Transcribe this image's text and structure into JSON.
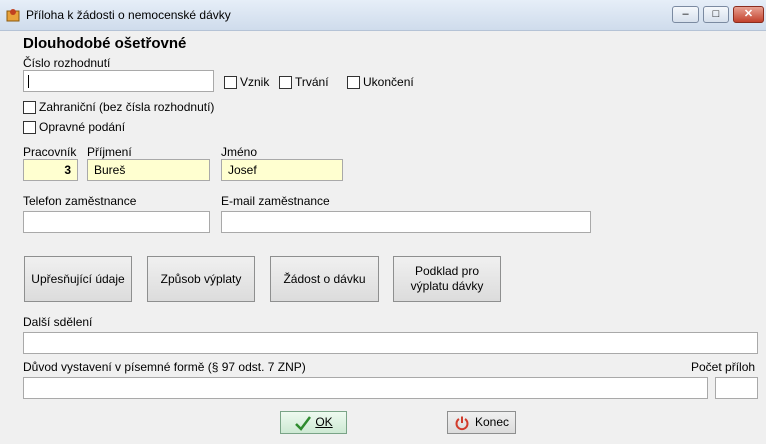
{
  "window": {
    "title": "Příloha k žádosti o nemocenské dávky"
  },
  "form": {
    "heading": "Dlouhodobé ošetřovné",
    "decision_number_label": "Číslo rozhodnutí",
    "decision_number_value": "",
    "checkbox_vznik": "Vznik",
    "checkbox_trvani": "Trvání",
    "checkbox_ukonceni": "Ukončení",
    "checkbox_zahranicni": "Zahraniční (bez čísla rozhodnutí)",
    "checkbox_opravne": "Opravné podání",
    "worker_label": "Pracovník",
    "worker_value": "3",
    "surname_label": "Příjmení",
    "surname_value": "Bureš",
    "name_label": "Jméno",
    "name_value": "Josef",
    "phone_label": "Telefon zaměstnance",
    "phone_value": "",
    "email_label": "E-mail zaměstnance",
    "email_value": "",
    "other_label": "Další sdělení",
    "other_value": "",
    "reason_label": "Důvod vystavení v písemné formě (§ 97 odst. 7 ZNP)",
    "reason_value": "",
    "attachments_label": "Počet příloh",
    "attachments_value": ""
  },
  "buttons": {
    "upresnujici": "Upřesňující údaje",
    "zpusob": "Způsob výplaty",
    "zadost": "Žádost o dávku",
    "podklad_line1": "Podklad pro",
    "podklad_line2": "výplatu dávky",
    "ok": "OK",
    "konec": "Konec"
  },
  "colors": {
    "highlight_field": "#ffffd0",
    "ok_check": "#2e8b2e",
    "power_icon": "#d13b2b"
  }
}
